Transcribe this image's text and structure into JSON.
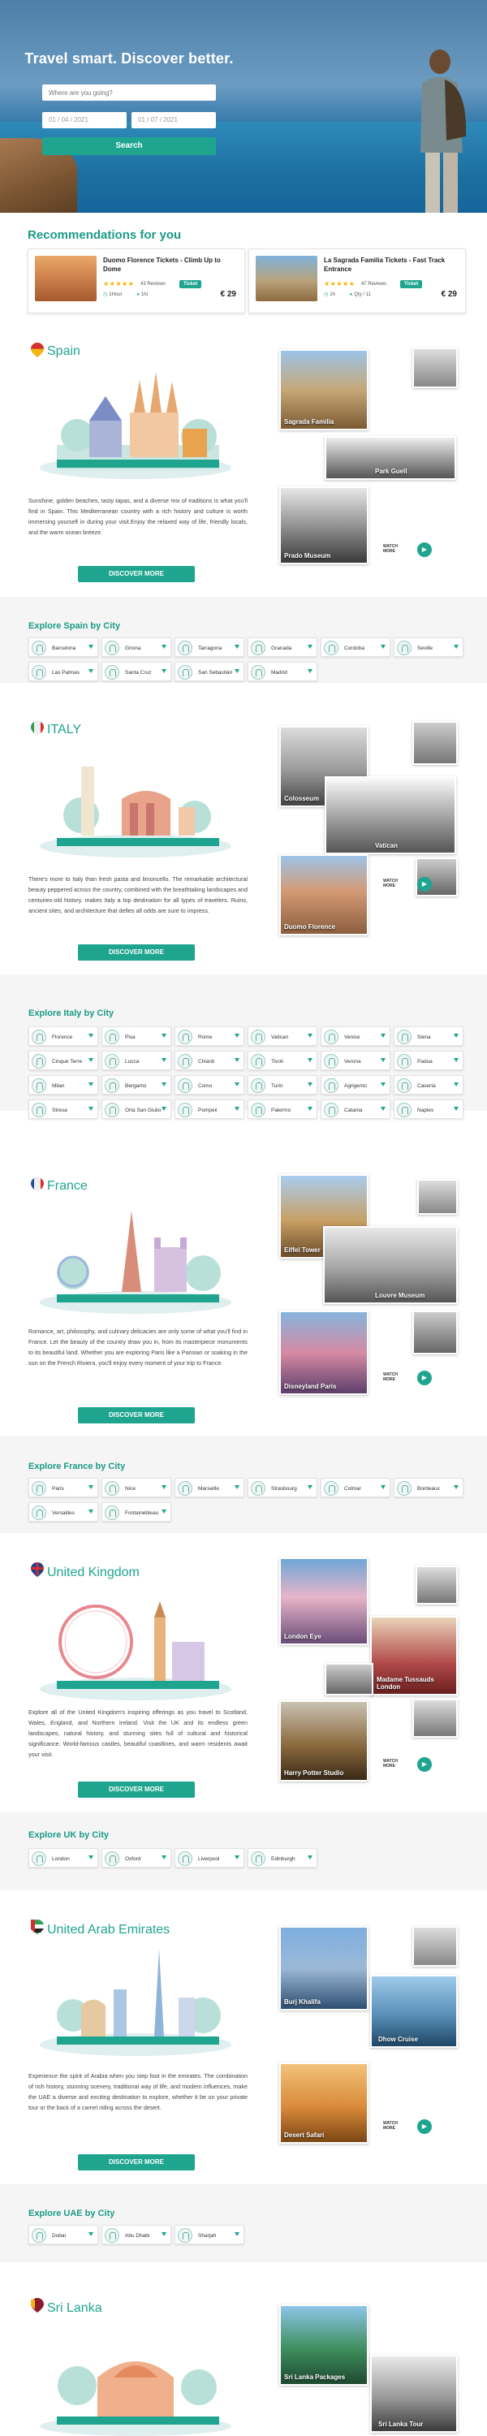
{
  "hero": {
    "title": "Travel smart. Discover better.",
    "search_placeholder": "Where are you going?",
    "date_from": "01 / 04 / 2021",
    "date_to": "01 / 07 / 2021",
    "search_label": "Search"
  },
  "recommendations": {
    "title": "Recommendations for you",
    "items": [
      {
        "name": "Duomo Florence Tickets - Climb Up to Dome",
        "stars": "★★★★★",
        "reviews": "43 Reviews",
        "badge": "Ticket",
        "duration": "1Hour",
        "people": "1hr",
        "price": "€ 29"
      },
      {
        "name": "La Sagrada Familia Tickets - Fast Track Entrance",
        "stars": "★★★★★",
        "reviews": "47 Reviews",
        "badge": "Ticket",
        "duration": "1h",
        "people": "Qty / 11",
        "price": "€ 29"
      }
    ]
  },
  "watch_more": "WATCH MORE",
  "discover_label": "DISCOVER MORE",
  "countries": [
    {
      "name": "Spain",
      "desc": "Sunshine, golden beaches, tasty tapas, and a diverse mix of traditions is what you'll find in Spain. This Mediterranean country with a rich history and culture is worth immersing yourself in during your visit.Enjoy the relaxed way of life, friendly locals, and the warm ocean breeze.",
      "photos": [
        "Sagrada Familia",
        "",
        "Park Guell",
        "",
        "Prado Museum"
      ],
      "explore_title": "Explore Spain by City",
      "cities": [
        "Barcelona",
        "Girona",
        "Tarragona",
        "Granada",
        "Cordoba",
        "Seville",
        "Las Palmas",
        "Santa Cruz",
        "San Sebastián",
        "Madrid"
      ]
    },
    {
      "name": "ITALY",
      "desc": "There's more to Italy than fresh pasta and limoncello. The remarkable architectural beauty peppered across the country, combined with the breathtaking landscapes and centuries-old history, makes Italy a top destination for all types of travelers. Ruins, ancient sites, and architecture that defies all odds are sure to impress.",
      "photos": [
        "Colosseum",
        "",
        "Vatican",
        "Duomo Florence",
        "",
        ""
      ],
      "explore_title": "Explore Italy by City",
      "cities": [
        "Florence",
        "Pisa",
        "Rome",
        "Vatican",
        "Venice",
        "Siena",
        "Cinque Terre",
        "Lucca",
        "Chianti",
        "Tivoli",
        "Verona",
        "Padua",
        "Milan",
        "Bergamo",
        "Como",
        "Turin",
        "Agrigento",
        "Caserta",
        "Stresa",
        "Orta San Giulio",
        "Pompeii",
        "Palermo",
        "Catania",
        "Naples"
      ]
    },
    {
      "name": "France",
      "desc": "Romance, art, philosophy, and culinary delicacies are only some of what you'll find in France. Let the beauty of the country draw you in, from its masterpiece monuments to its beautiful land. Whether you are exploring Paris like a Parisian or soaking in the sun on the French Riviera, you'll enjoy every moment of your trip to France.",
      "photos": [
        "Eiffel Tower",
        "",
        "Louvre Museum",
        "",
        "Disneyland Paris"
      ],
      "explore_title": "Explore France by City",
      "cities": [
        "Paris",
        "Nice",
        "Marseille",
        "Strasbourg",
        "Colmar",
        "Bordeaux",
        "Versailles",
        "Fontainebleau"
      ]
    },
    {
      "name": "United Kingdom",
      "desc": "Explore all of the United Kingdom's inspiring offerings as you travel to Scotland, Wales, England, and Northern Ireland. Visit the UK and its endless green landscapes, natural history, and stunning sites full of cultural and historical significance. World-famous castles, beautiful coastlines, and warm residents await your visit.",
      "photos": [
        "London Eye",
        "",
        "Madame Tussauds London",
        "",
        "Harry Potter Studio",
        ""
      ],
      "explore_title": "Explore UK by City",
      "cities": [
        "London",
        "Oxford",
        "Liverpool",
        "Edinburgh"
      ]
    },
    {
      "name": "United Arab Emirates",
      "desc": "Experience the spirit of Arabia when you step foot in the emirates. The combination of rich history, stunning scenery, traditional way of life, and modern influences, make the UAE a diverse and exciting destination to explore, whether it be on your private tour or the back of a camel riding across the desert.",
      "photos": [
        "Burj Khalifa",
        "",
        "Dhow Cruise",
        "Desert Safari"
      ],
      "explore_title": "Explore UAE by City",
      "cities": [
        "Dubai",
        "Abu Dhabi",
        "Sharjah"
      ]
    },
    {
      "name": "Sri Lanka",
      "photos": [
        "Sri Lanka Packages",
        "Sri Lanka Tour"
      ]
    }
  ]
}
